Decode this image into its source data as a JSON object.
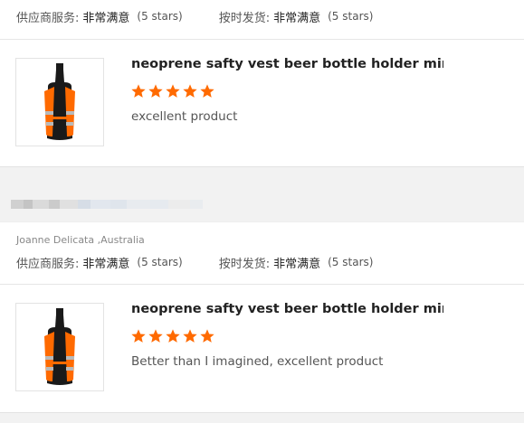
{
  "reviews": [
    {
      "buyer": "",
      "supplier_label": "供应商服务:",
      "supplier_value": "非常满意",
      "supplier_stars": "(5 stars)",
      "shipping_label": "按时发货:",
      "shipping_value": "非常满意",
      "shipping_stars": "(5 stars)",
      "product_title": "neoprene safty vest beer bottle holder mini tac...",
      "rating": 5,
      "comment": "excellent product"
    },
    {
      "buyer": "Joanne Delicata ,Australia",
      "supplier_label": "供应商服务:",
      "supplier_value": "非常满意",
      "supplier_stars": "(5 stars)",
      "shipping_label": "按时发货:",
      "shipping_value": "非常满意",
      "shipping_stars": "(5 stars)",
      "product_title": "neoprene safty vest beer bottle holder mini tac...",
      "rating": 5,
      "comment": "Better than I imagined, excellent product"
    }
  ],
  "colors": {
    "star": "#ff6a00",
    "vest_orange": "#ff6a00",
    "reflective_stripe": "#b9b9b9",
    "bottle": "#1a1a1a"
  },
  "icons": {
    "star": "star-icon",
    "thumbnail": "beer-bottle-vest-product-image"
  }
}
